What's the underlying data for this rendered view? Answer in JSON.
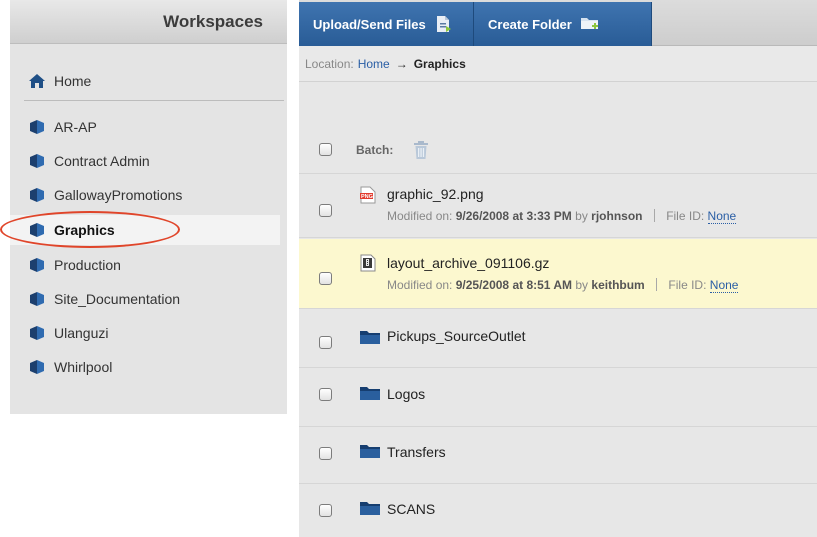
{
  "sidebar": {
    "title": "Workspaces",
    "home_label": "Home",
    "items": [
      {
        "label": "AR-AP"
      },
      {
        "label": "Contract Admin"
      },
      {
        "label": "GallowayPromotions"
      },
      {
        "label": "Graphics"
      },
      {
        "label": "Production"
      },
      {
        "label": "Site_Documentation"
      },
      {
        "label": "Ulanguzi"
      },
      {
        "label": "Whirlpool"
      }
    ],
    "active_item": "Graphics"
  },
  "toolbar": {
    "upload_label": "Upload/Send Files",
    "create_folder_label": "Create Folder"
  },
  "location": {
    "prefix": "Location:",
    "home": "Home",
    "current": "Graphics"
  },
  "batch": {
    "label": "Batch:"
  },
  "files": [
    {
      "name": "graphic_92.png",
      "icon": "png-file-icon",
      "modified_prefix": "Modified on:",
      "modified": "9/26/2008 at 3:33 PM",
      "by_label": "by",
      "user": "rjohnson",
      "file_id_label": "File ID:",
      "file_id": "None"
    },
    {
      "name": "layout_archive_091106.gz",
      "icon": "archive-file-icon",
      "modified_prefix": "Modified on:",
      "modified": "9/25/2008 at 8:51 AM",
      "by_label": "by",
      "user": "keithbum",
      "file_id_label": "File ID:",
      "file_id": "None"
    }
  ],
  "folders": [
    {
      "name": "Pickups_SourceOutlet"
    },
    {
      "name": "Logos"
    },
    {
      "name": "Transfers"
    },
    {
      "name": "SCANS"
    }
  ],
  "colors": {
    "accent_blue": "#2d64a2",
    "link": "#2a5ea5",
    "highlight_ring": "#e0452a",
    "selected_row": "#fcf8cf"
  }
}
